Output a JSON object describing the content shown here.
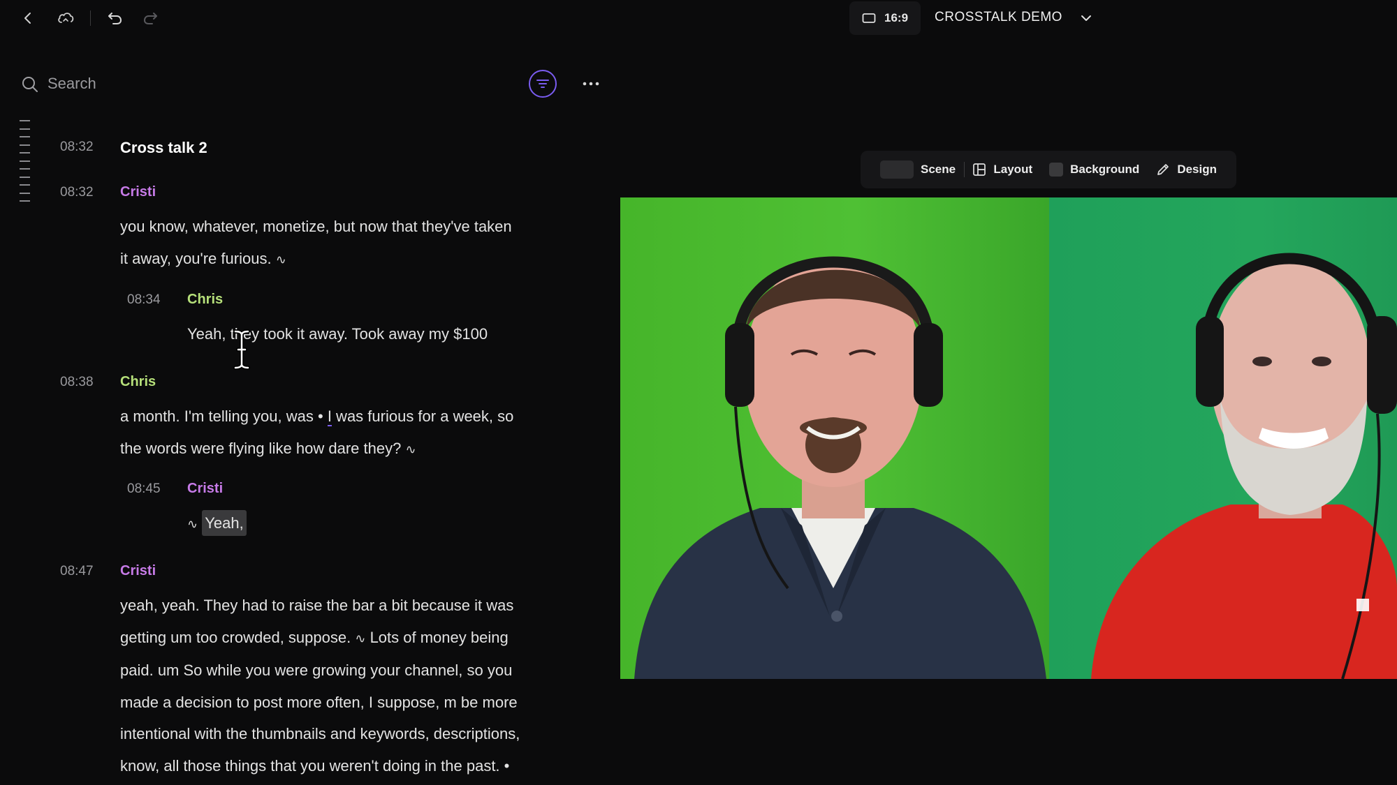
{
  "topbar": {
    "aspect_ratio": "16:9",
    "project_title": "CROSSTALK DEMO"
  },
  "search": {
    "placeholder": "Search"
  },
  "transcript": {
    "section": {
      "time": "08:32",
      "title": "Cross talk 2"
    },
    "blocks": [
      {
        "time": "08:32",
        "speaker": "Cristi",
        "lines": [
          "you know, whatever, monetize, but now that they've taken",
          "it away, you're furious."
        ]
      },
      {
        "time": "08:34",
        "speaker": "Chris",
        "lines": [
          "Yeah, they took it away. Took away my $100"
        ]
      },
      {
        "time": "08:38",
        "speaker": "Chris",
        "line1_before": "a month. I'm telling you, was • ",
        "line1_cursor": "I",
        "line1_after": " was furious for a week, so",
        "line2": "the words were flying like how dare they?"
      },
      {
        "time": "08:45",
        "speaker": "Cristi",
        "highlighted": "Yeah,"
      },
      {
        "time": "08:47",
        "speaker": "Cristi",
        "lines": [
          "yeah, yeah. They had to raise the bar a bit because it was",
          "getting um too crowded, suppose.",
          "Lots of money being",
          "paid. um So while you were growing your channel, so you",
          "made a decision to post more often, I suppose, m be more",
          "intentional with the thumbnails and keywords, descriptions,",
          "know, all those things that you weren't doing in the past. •"
        ]
      }
    ]
  },
  "scene_toolbar": {
    "scene_label": "Scene",
    "layout_label": "Layout",
    "background_label": "Background",
    "design_label": "Design"
  },
  "colors": {
    "accent": "#7a5cf0",
    "speaker_cristi": "#c77be8",
    "speaker_chris": "#b6e07a"
  }
}
